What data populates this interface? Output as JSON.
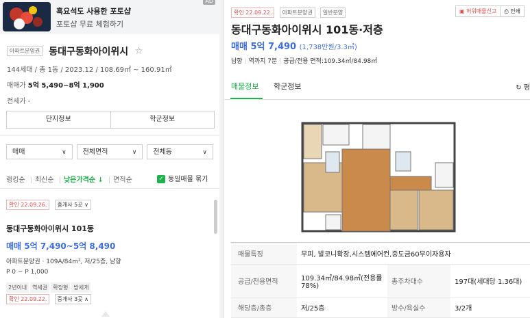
{
  "ad": {
    "title": "흑요석도 사용한 포토샵",
    "subtitle": "포토샵 무료 체험하기",
    "badge": "AD"
  },
  "complex": {
    "tag": "아파트분양권",
    "name": "동대구동화아이위시",
    "info": "144세대 / 총 1동 / 2023.12 / 108.69㎡ ~ 160.91㎡",
    "price_label": "매매가",
    "price_value": "5억 5,490~8억 1,900",
    "jeonse": "전세가 -"
  },
  "tab_buttons": [
    "단지정보",
    "학군정보"
  ],
  "filters": [
    "매매",
    "전체면적",
    "전체동"
  ],
  "sort": {
    "items": [
      "랭킹순",
      "최신순",
      "낮은가격순 ↓",
      "면적순"
    ],
    "active_index": 2,
    "same_listing_label": "동일매물 묶기"
  },
  "listing_top": {
    "confirm": "확인 22.09.26.",
    "agents": "중개사 5곳"
  },
  "listing": {
    "name": "동대구동화아이위시 101동",
    "price": "매매 5억 7,490~5억 8,490",
    "spec": "아파트분양권 · 109A/84m², 저/25층, 남향",
    "pyung": "P 0 ~ P 1,000",
    "chips": [
      "2년이내",
      "역세권",
      "확장형",
      "방세개"
    ],
    "confirm": "확인 22.09.22.",
    "agents": "중개사 3곳"
  },
  "detail": {
    "confirm": "확인 22.09.22.",
    "tags": [
      "아파트분양권",
      "일반분양"
    ],
    "report_label": "허위매물신고",
    "print_label": "인쇄",
    "title": "동대구동화아이위시 101동·저층",
    "price": "매매 5억 7,490",
    "price_per": "(1,738만원/3.3㎡)",
    "sub": [
      "남향",
      "역까지 7분",
      "공급/전용 면적:109.34㎡/84.98㎡"
    ],
    "tabs": [
      "매물정보",
      "학군정보"
    ],
    "refresh": "평",
    "table": [
      {
        "k1": "매물특징",
        "v1": "무피, 발코니확장,시스템에어컨,중도금60무이자용자"
      },
      {
        "k1": "공급/전용면적",
        "v1": "109.34㎡/84.98㎡(전용률78%)",
        "k2": "총주차대수",
        "v2": "197대(세대당 1.36대)"
      },
      {
        "k1": "해당층/총층",
        "v1": "저/25층",
        "k2": "방수/욕실수",
        "v2": "3/2개"
      }
    ]
  },
  "colors": {
    "accent_green": "#1cb44a",
    "price_blue": "#3d6ee0",
    "confirm_red": "#e84a4a"
  }
}
